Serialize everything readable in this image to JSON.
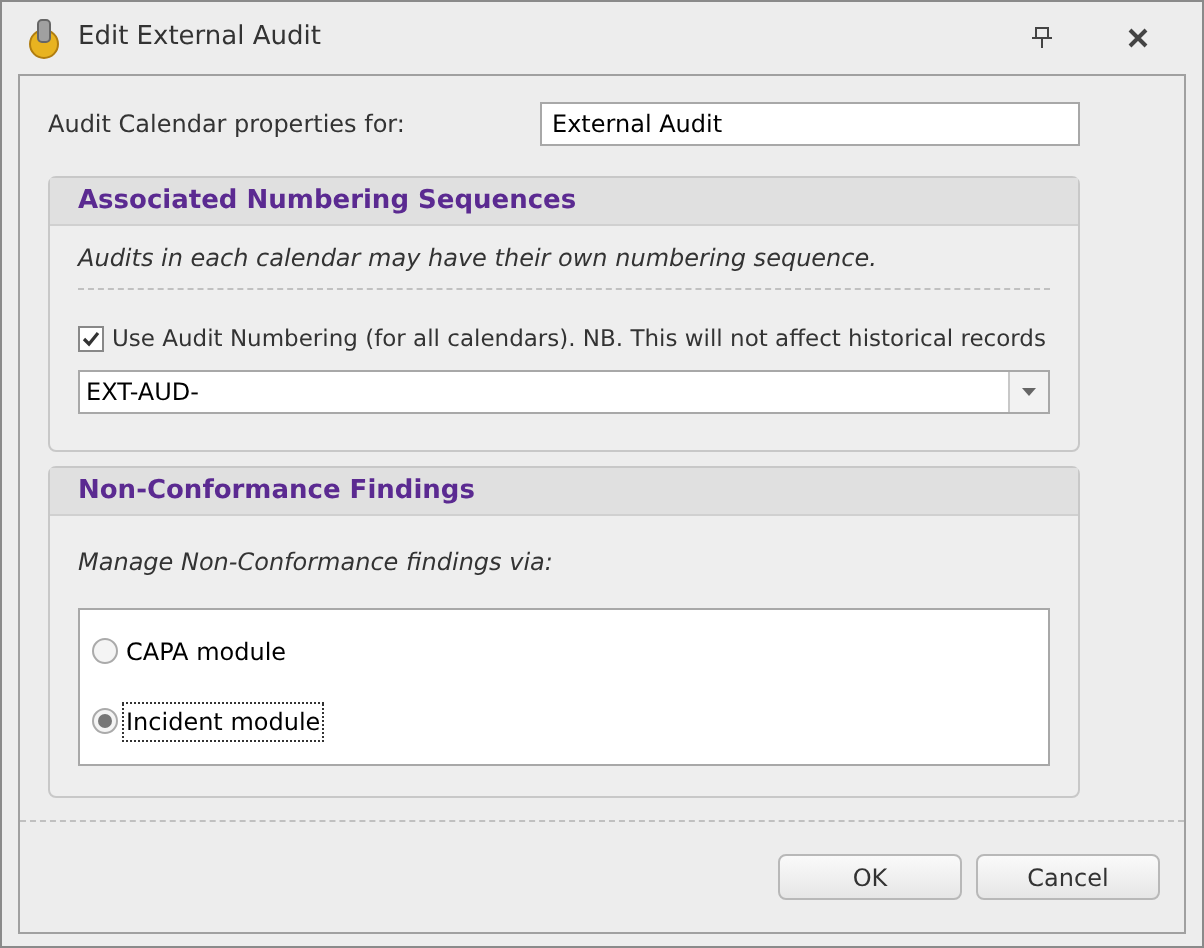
{
  "window": {
    "title": "Edit External Audit"
  },
  "calendar": {
    "label": "Audit Calendar properties for:",
    "value": "External Audit"
  },
  "numbering": {
    "title": "Associated Numbering Sequences",
    "note": "Audits in each calendar may have their own numbering sequence.",
    "checkbox": {
      "label": "Use Audit Numbering (for all calendars). NB. This will not affect historical records",
      "checked": true
    },
    "sequence": {
      "value": "EXT-AUD-"
    }
  },
  "findings": {
    "title": "Non-Conformance Findings",
    "note": "Manage Non-Conformance findings via:",
    "options": [
      {
        "label": "CAPA module",
        "selected": false
      },
      {
        "label": "Incident module",
        "selected": true
      }
    ]
  },
  "buttons": [
    "OK",
    "Cancel"
  ]
}
